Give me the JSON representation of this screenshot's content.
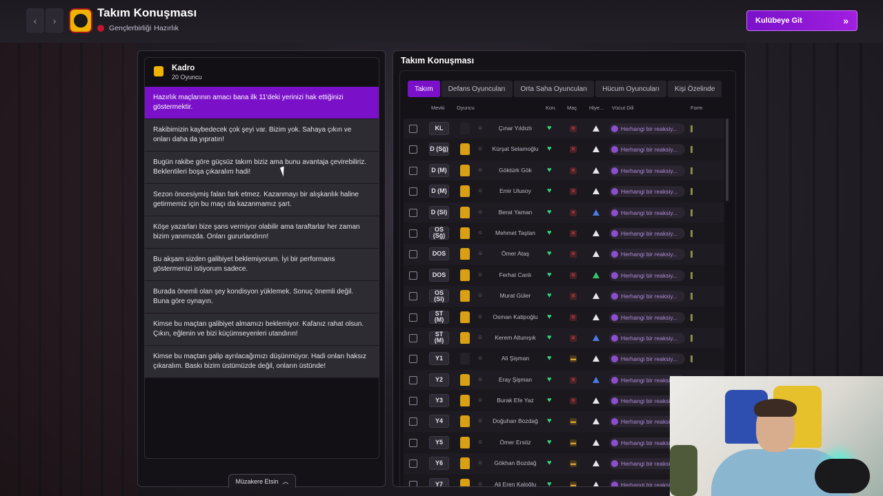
{
  "header": {
    "title": "Takım Konuşması",
    "breadcrumbs": [
      "Gençlerbirliği",
      "Hazırlık"
    ],
    "go_button": "Kulübeye Git"
  },
  "squad": {
    "title": "Kadro",
    "subtitle": "20 Oyuncu"
  },
  "talk_options": [
    "Hazırlık maçlarının amacı bana ilk 11'deki yerinizi hak ettiğinizi göstermektir.",
    "Rakibimizin kaybedecek çok şeyi var. Bizim yok. Sahaya çıkın ve onları daha da yıpratın!",
    "Bugün rakibe göre güçsüz takım biziz ama bunu avantaja çevirebiliriz. Beklentileri boşa çıkaralım hadi!",
    "Sezon öncesiymiş falan fark etmez. Kazanmayı bir alışkanlık haline getirmemiz için bu maçı da kazanmamız şart.",
    "Köşe yazarları bize şans vermiyor olabilir ama taraftarlar her zaman bizim yanımızda. Onları gururlandırın!",
    "Bu akşam sizden galibiyet beklemiyorum. İyi bir performans göstermenizi istiyorum sadece.",
    "Burada önemli olan şey kondisyon yüklemek. Sonuç önemli değil. Buna göre oynayın.",
    "Kimse bu maçtan galibiyet almamızı beklemiyor. Kafanız rahat olsun. Çıkın, eğlenin ve bizi küçümseyenleri utandırın!",
    "Kimse bu maçtan galip ayrılacağımızı düşünmüyor. Hadi onları haksız çıkaralım. Baskı bizim üstümüzde değil, onların üstünde!"
  ],
  "negotiate_button": "Müzakere Etsin",
  "panel": {
    "title": "Takım Konuşması",
    "tabs": [
      "Takım",
      "Defans Oyuncuları",
      "Orta Saha Oyuncuları",
      "Hücum Oyuncuları",
      "Kişi Özelinde"
    ],
    "columns": {
      "position": "Mevki",
      "player": "Oyuncu",
      "con": "Kon.",
      "match": "Maç",
      "hier": "Hiye...",
      "body": "Vücut Dili",
      "form": "Form"
    },
    "reaction_text": "Herhangi bir reaksiy..."
  },
  "players": [
    {
      "pos": "KL",
      "name": "Çınar Yıldızlı",
      "shirt": "dark",
      "match": "x",
      "hier": "white"
    },
    {
      "pos": "D (Sğ)",
      "name": "Kürşat Selamoğlu",
      "shirt": "gold",
      "match": "x",
      "hier": "white"
    },
    {
      "pos": "D (M)",
      "name": "Göktürk Gök",
      "shirt": "gold",
      "match": "x",
      "hier": "white"
    },
    {
      "pos": "D (M)",
      "name": "Emir Ulusoy",
      "shirt": "gold",
      "match": "x",
      "hier": "white"
    },
    {
      "pos": "D (Sl)",
      "name": "Berat Yaman",
      "shirt": "gold",
      "match": "x",
      "hier": "blue"
    },
    {
      "pos": "OS (Sğ)",
      "name": "Mehmet Taştan",
      "shirt": "gold",
      "match": "x",
      "hier": "white"
    },
    {
      "pos": "DOS",
      "name": "Ömer Ataş",
      "shirt": "gold",
      "match": "x",
      "hier": "white"
    },
    {
      "pos": "DOS",
      "name": "Ferhat Canlı",
      "shirt": "gold",
      "match": "x",
      "hier": "green"
    },
    {
      "pos": "OS (Sl)",
      "name": "Murat Güler",
      "shirt": "gold",
      "match": "x",
      "hier": "white"
    },
    {
      "pos": "ST (M)",
      "name": "Osman Katipoğlu",
      "shirt": "gold",
      "match": "x",
      "hier": "white"
    },
    {
      "pos": "ST (M)",
      "name": "Kerem Altunışık",
      "shirt": "gold",
      "match": "x",
      "hier": "blue"
    },
    {
      "pos": "Y1",
      "name": "Ali Şişman",
      "shirt": "dark",
      "match": "m",
      "hier": "white"
    },
    {
      "pos": "Y2",
      "name": "Eray Şişman",
      "shirt": "gold",
      "match": "x",
      "hier": "blue"
    },
    {
      "pos": "Y3",
      "name": "Burak Efe Yaz",
      "shirt": "gold",
      "match": "x",
      "hier": "white"
    },
    {
      "pos": "Y4",
      "name": "Doğuhan Bozdağ",
      "shirt": "gold",
      "match": "m",
      "hier": "white"
    },
    {
      "pos": "Y5",
      "name": "Ömer Ersöz",
      "shirt": "gold",
      "match": "m",
      "hier": "white"
    },
    {
      "pos": "Y6",
      "name": "Gökhan Bozdağ",
      "shirt": "gold",
      "match": "m",
      "hier": "white"
    },
    {
      "pos": "Y7",
      "name": "Ali Eren Kaloğlu",
      "shirt": "gold",
      "match": "m",
      "hier": "white"
    }
  ]
}
